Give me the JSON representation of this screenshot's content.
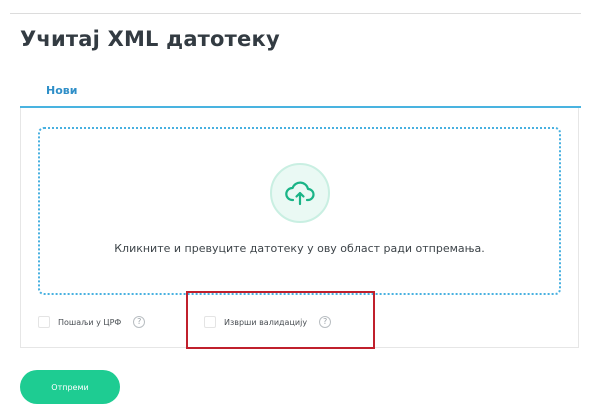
{
  "page": {
    "title": "Учитај XML датотеку"
  },
  "tabs": [
    {
      "label": "Нови",
      "active": true
    }
  ],
  "dropzone": {
    "icon": "cloud-upload-icon",
    "text": "Кликните и превуците датотеку у ову област ради отпремања."
  },
  "options": {
    "send_to_crf": {
      "label": "Пошаљи у ЦРФ",
      "checked": false,
      "icon": "help-circle-icon"
    },
    "validate": {
      "label": "Изврши валидацију",
      "checked": false,
      "icon": "help-circle-icon"
    }
  },
  "actions": {
    "submit_label": "Отпреми"
  },
  "colors": {
    "accent_blue": "#49b3e0",
    "accent_green": "#1ecc92",
    "highlight_red": "#c0202c"
  }
}
